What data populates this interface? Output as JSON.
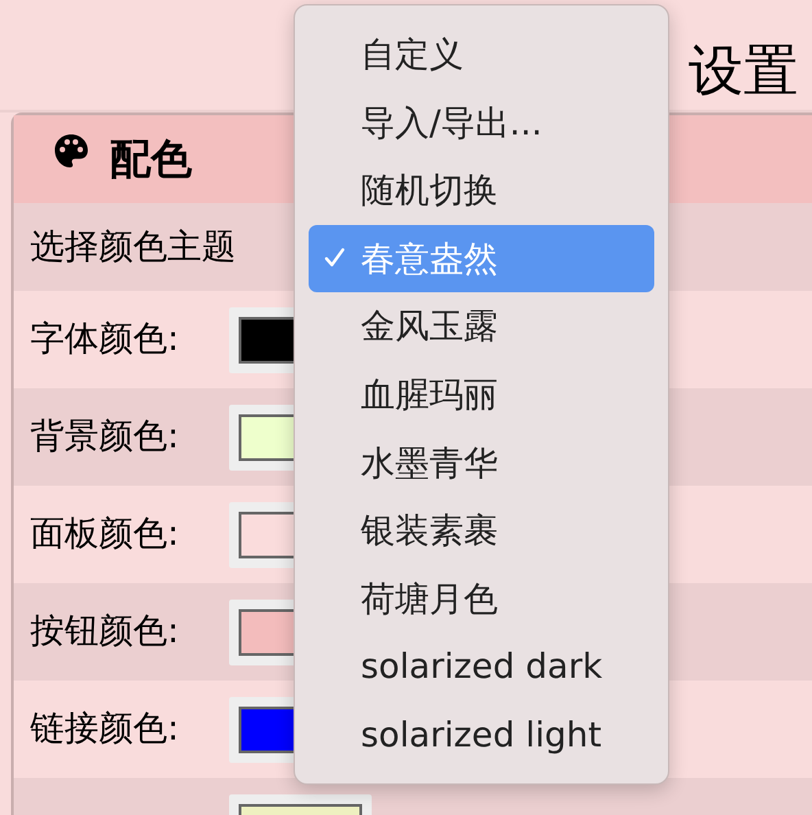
{
  "page": {
    "title": "设置"
  },
  "panel": {
    "title": "配色"
  },
  "theme_row": {
    "label": "选择颜色主题"
  },
  "color_rows": [
    {
      "label": "字体颜色:",
      "color": "#000000"
    },
    {
      "label": "背景颜色:",
      "color": "#eeffcc"
    },
    {
      "label": "面板颜色:",
      "color": "#fadcdc"
    },
    {
      "label": "按钮颜色:",
      "color": "#f3bcbc"
    },
    {
      "label": "链接颜色:",
      "color": "#0000ff"
    },
    {
      "color": "#eef0c0"
    }
  ],
  "theme_menu": {
    "items": [
      {
        "label": "自定义",
        "selected": false
      },
      {
        "label": "导入/导出...",
        "selected": false
      },
      {
        "label": "随机切换",
        "selected": false
      },
      {
        "label": "春意盎然",
        "selected": true
      },
      {
        "label": "金风玉露",
        "selected": false
      },
      {
        "label": "血腥玛丽",
        "selected": false
      },
      {
        "label": "水墨青华",
        "selected": false
      },
      {
        "label": "银装素裹",
        "selected": false
      },
      {
        "label": "荷塘月色",
        "selected": false
      },
      {
        "label": "solarized dark",
        "selected": false
      },
      {
        "label": "solarized light",
        "selected": false
      }
    ]
  }
}
